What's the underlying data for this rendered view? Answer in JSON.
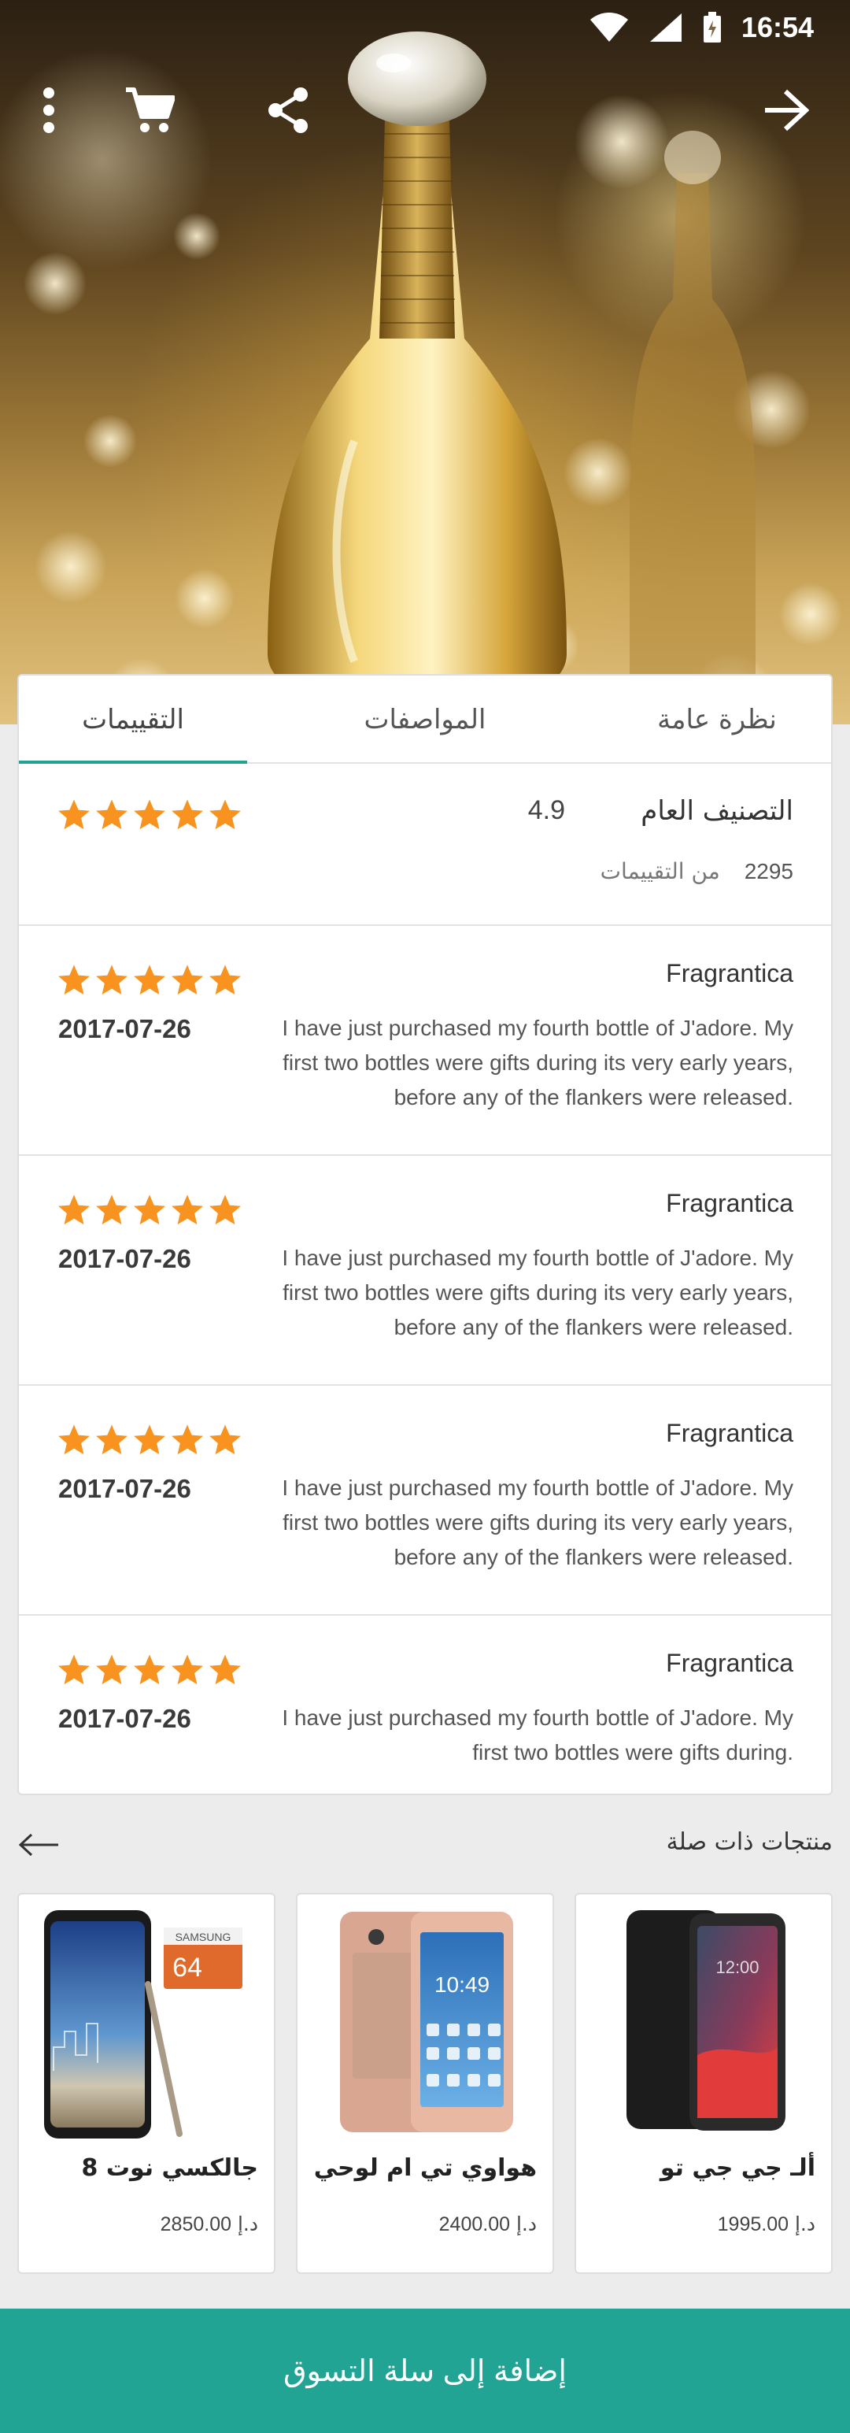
{
  "status_bar": {
    "time": "16:54"
  },
  "hero": {
    "icons": [
      "more-vert-icon",
      "cart-icon",
      "share-icon",
      "back-arrow-icon"
    ]
  },
  "tabs": [
    {
      "label": "نظرة عامة",
      "active": false
    },
    {
      "label": "المواصفات",
      "active": false
    },
    {
      "label": "التقييمات",
      "active": true
    }
  ],
  "summary": {
    "label": "التصنيف العام",
    "score": "4.9",
    "count": "2295",
    "count_label": "من التقييمات",
    "stars": 5
  },
  "reviews": [
    {
      "author": "Fragrantica",
      "date": "2017-07-26",
      "stars": 5,
      "text": "I have just purchased my fourth bottle of J'adore. My first two bottles were gifts during its very early years, before any of the flankers were released."
    },
    {
      "author": "Fragrantica",
      "date": "2017-07-26",
      "stars": 5,
      "text": "I have just purchased my fourth bottle of J'adore. My first two bottles were gifts during its very early years, before any of the flankers were released."
    },
    {
      "author": "Fragrantica",
      "date": "2017-07-26",
      "stars": 5,
      "text": "I have just purchased my fourth bottle of J'adore. My first two bottles were gifts during its very early years, before any of the flankers were released."
    },
    {
      "author": "Fragrantica",
      "date": "2017-07-26",
      "stars": 5,
      "text": "I have just purchased my fourth bottle of J'adore. My first two bottles were gifts during."
    }
  ],
  "related": {
    "title": "منتجات ذات صلة",
    "products": [
      {
        "name": "ألـ جي جي تو",
        "price": "1995.00",
        "currency": "د.إ"
      },
      {
        "name": "هواوي تي ام لوحي",
        "price": "2400.00",
        "currency": "د.إ"
      },
      {
        "name": "جالكسي نوت 8",
        "price": "2850.00",
        "currency": "د.إ"
      }
    ]
  },
  "product_image_text": {
    "samsung": "SAMSUNG",
    "capacity": "64",
    "clock": "10:49",
    "lg_clock": "12:00"
  },
  "add_to_cart_label": "إضافة إلى سلة التسوق",
  "colors": {
    "accent": "#21a494",
    "star": "#f7931e"
  }
}
